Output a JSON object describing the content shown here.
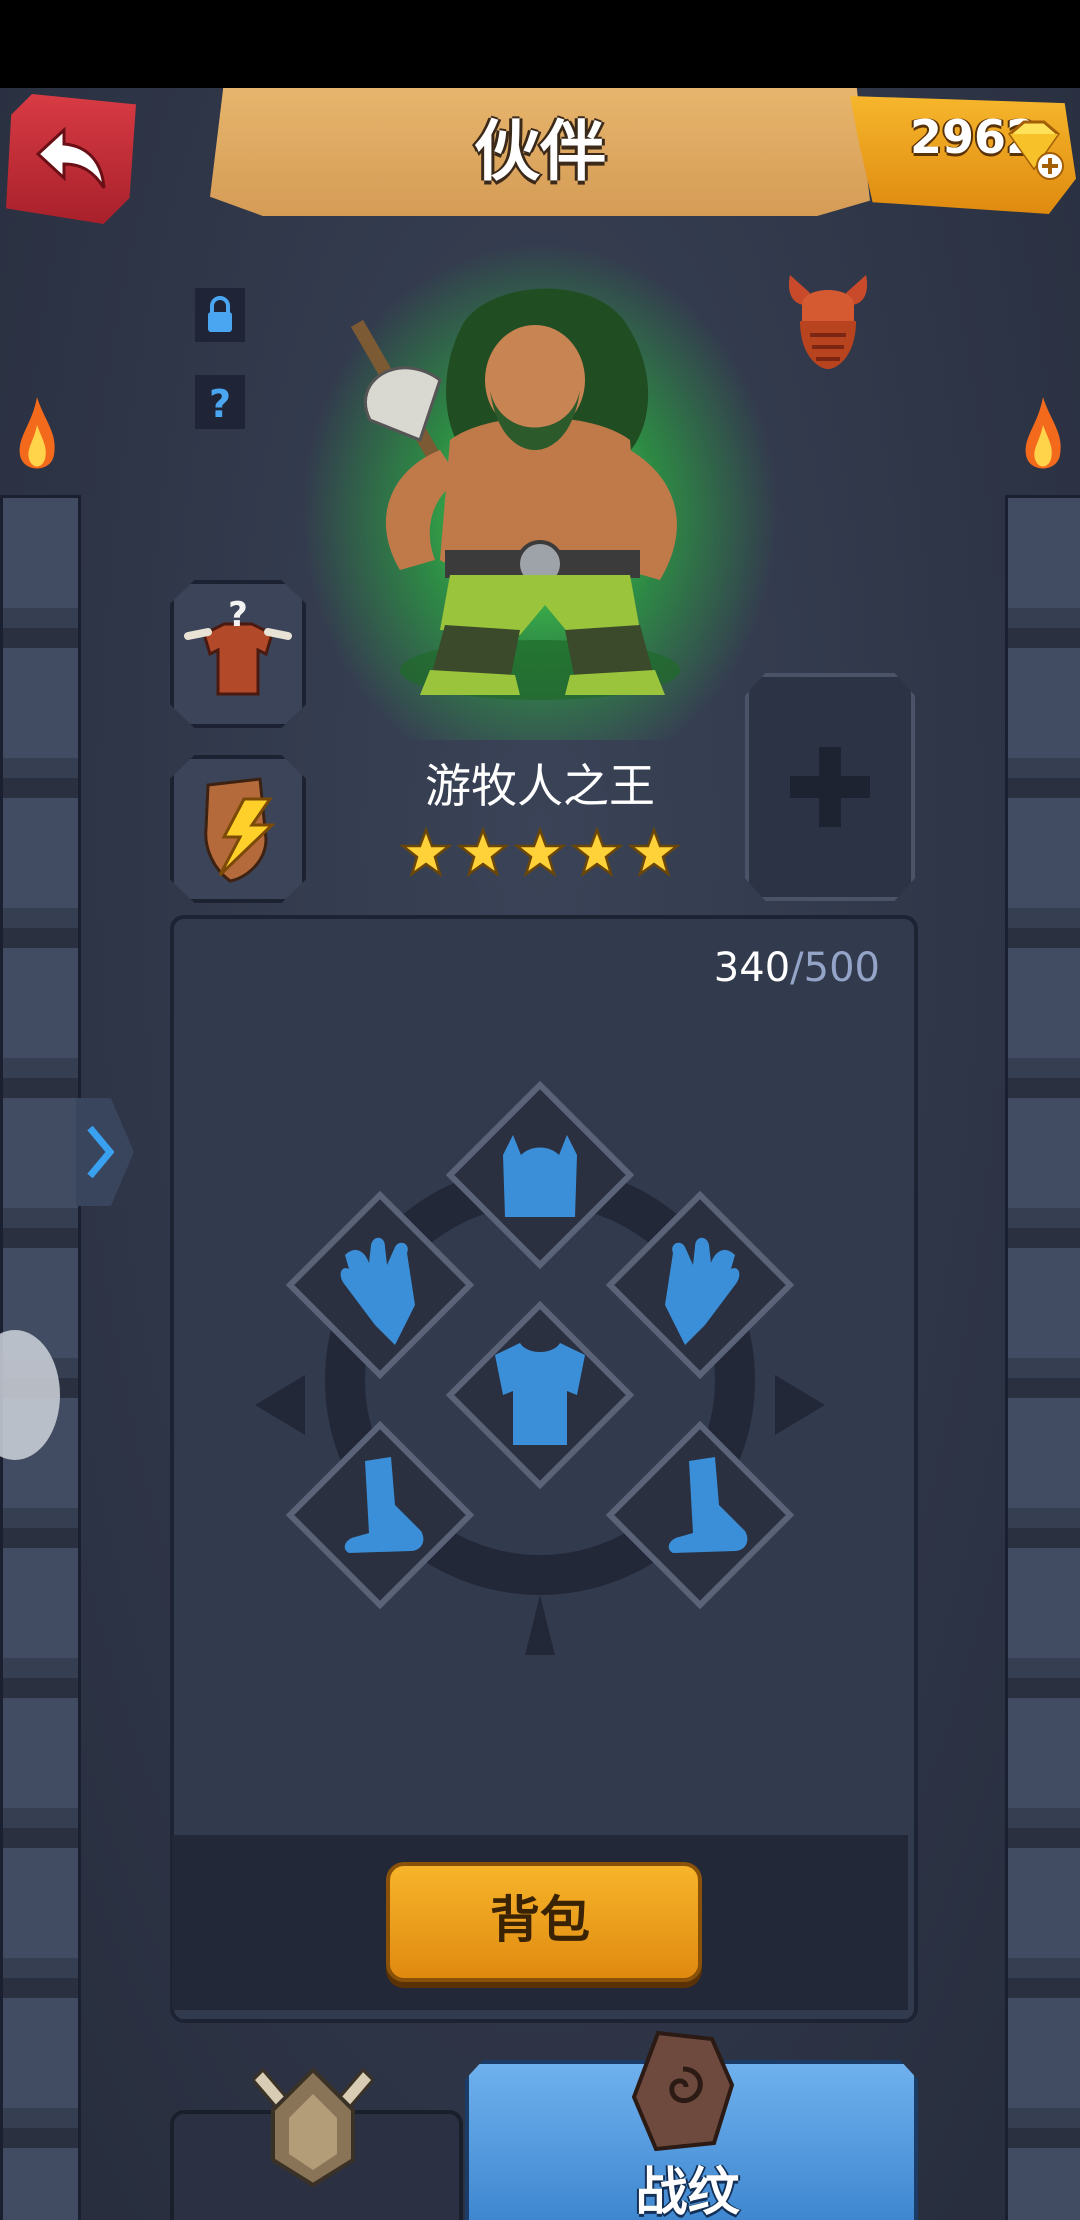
{
  "header": {
    "title": "伙伴",
    "back_button": "back-arrow-icon",
    "gem_count": "2962",
    "gem_icon": "gem-plus-icon"
  },
  "hero": {
    "name": "游牧人之王",
    "stars": 5,
    "max_stars": 5,
    "faction_icon": "horned-helmet-icon",
    "status_icons": [
      "lock-icon",
      "question-icon"
    ],
    "slots": [
      {
        "name": "outfit-slot",
        "icon": "outfit-question-icon"
      },
      {
        "name": "ability-slot",
        "icon": "shield-lightning-icon"
      },
      {
        "name": "add-slot",
        "icon": "plus-icon"
      }
    ]
  },
  "equipment": {
    "capacity_current": "340",
    "capacity_separator": "/",
    "capacity_max": "500",
    "slots": [
      "helmet-icon",
      "left-glove-icon",
      "right-glove-icon",
      "armor-icon",
      "left-boot-icon",
      "right-boot-icon"
    ],
    "bag_button": "背包"
  },
  "bottom_tabs": [
    {
      "name": "partner-tab",
      "label": "",
      "icon": "crossed-swords-icon",
      "active": false
    },
    {
      "name": "rune-tab",
      "label": "战纹",
      "icon": "rune-stone-icon",
      "active": true
    }
  ],
  "colors": {
    "background": "#2f3648",
    "banner": "#e0a860",
    "gem_badge": "#f0a020",
    "back_button": "#c0303a",
    "bag_button": "#f0a020",
    "active_tab": "#4a94dc",
    "slot_icon": "#3b8fd8",
    "hero_glow": "#50ff50"
  }
}
